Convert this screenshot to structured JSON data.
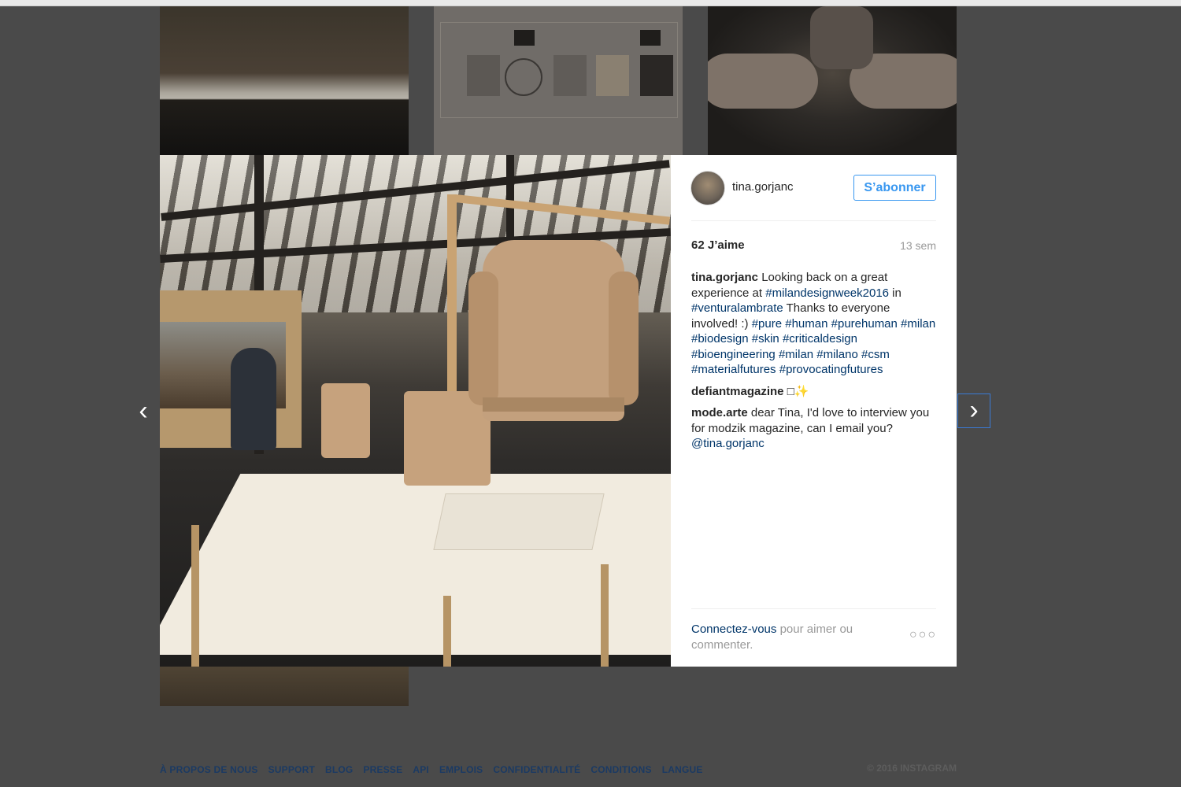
{
  "post": {
    "username": "tina.gorjanc",
    "follow_label": "S’abonner",
    "likes": "62 J’aime",
    "age": "13 sem",
    "comments": [
      {
        "author": "tina.gorjanc",
        "segments": [
          {
            "text": "Looking back on a great experience at ",
            "tag": false
          },
          {
            "text": "#milandesignweek2016",
            "tag": true
          },
          {
            "text": " in ",
            "tag": false
          },
          {
            "text": "#venturalambrate",
            "tag": true
          },
          {
            "text": " Thanks to everyone involved! :) ",
            "tag": false
          },
          {
            "text": "#pure",
            "tag": true
          },
          {
            "text": " ",
            "tag": false
          },
          {
            "text": "#human",
            "tag": true
          },
          {
            "text": " ",
            "tag": false
          },
          {
            "text": "#purehuman",
            "tag": true
          },
          {
            "text": " ",
            "tag": false
          },
          {
            "text": "#milan",
            "tag": true
          },
          {
            "text": " ",
            "tag": false
          },
          {
            "text": "#biodesign",
            "tag": true
          },
          {
            "text": " ",
            "tag": false
          },
          {
            "text": "#skin",
            "tag": true
          },
          {
            "text": " ",
            "tag": false
          },
          {
            "text": "#criticaldesign",
            "tag": true
          },
          {
            "text": " ",
            "tag": false
          },
          {
            "text": "#bioengineering",
            "tag": true
          },
          {
            "text": " ",
            "tag": false
          },
          {
            "text": "#milan",
            "tag": true
          },
          {
            "text": " ",
            "tag": false
          },
          {
            "text": "#milano",
            "tag": true
          },
          {
            "text": " ",
            "tag": false
          },
          {
            "text": "#csm",
            "tag": true
          },
          {
            "text": " ",
            "tag": false
          },
          {
            "text": "#materialfutures",
            "tag": true
          },
          {
            "text": " ",
            "tag": false
          },
          {
            "text": "#provocatingfutures",
            "tag": true
          }
        ]
      },
      {
        "author": "defiantmagazine",
        "segments": [
          {
            "text": "□✨",
            "tag": false
          }
        ]
      },
      {
        "author": "mode.arte",
        "segments": [
          {
            "text": "dear Tina, I'd love to interview you for modzik magazine, can I email you? ",
            "tag": false
          },
          {
            "text": "@tina.gorjanc",
            "tag": true
          }
        ]
      }
    ],
    "login_link": "Connectez-vous",
    "login_text": " pour aimer ou commenter.",
    "more_label": "○○○"
  },
  "nav": {
    "prev_label": "‹",
    "next_label": "›"
  },
  "footer": {
    "links": [
      "À PROPOS DE NOUS",
      "SUPPORT",
      "BLOG",
      "PRESSE",
      "API",
      "EMPLOIS",
      "CONFIDENTIALITÉ",
      "CONDITIONS",
      "LANGUE"
    ],
    "copyright": "© 2016 INSTAGRAM"
  },
  "colors": {
    "backdrop": "#4a4a4a",
    "accent": "#3897f0",
    "link": "#003569",
    "muted": "#999999"
  }
}
